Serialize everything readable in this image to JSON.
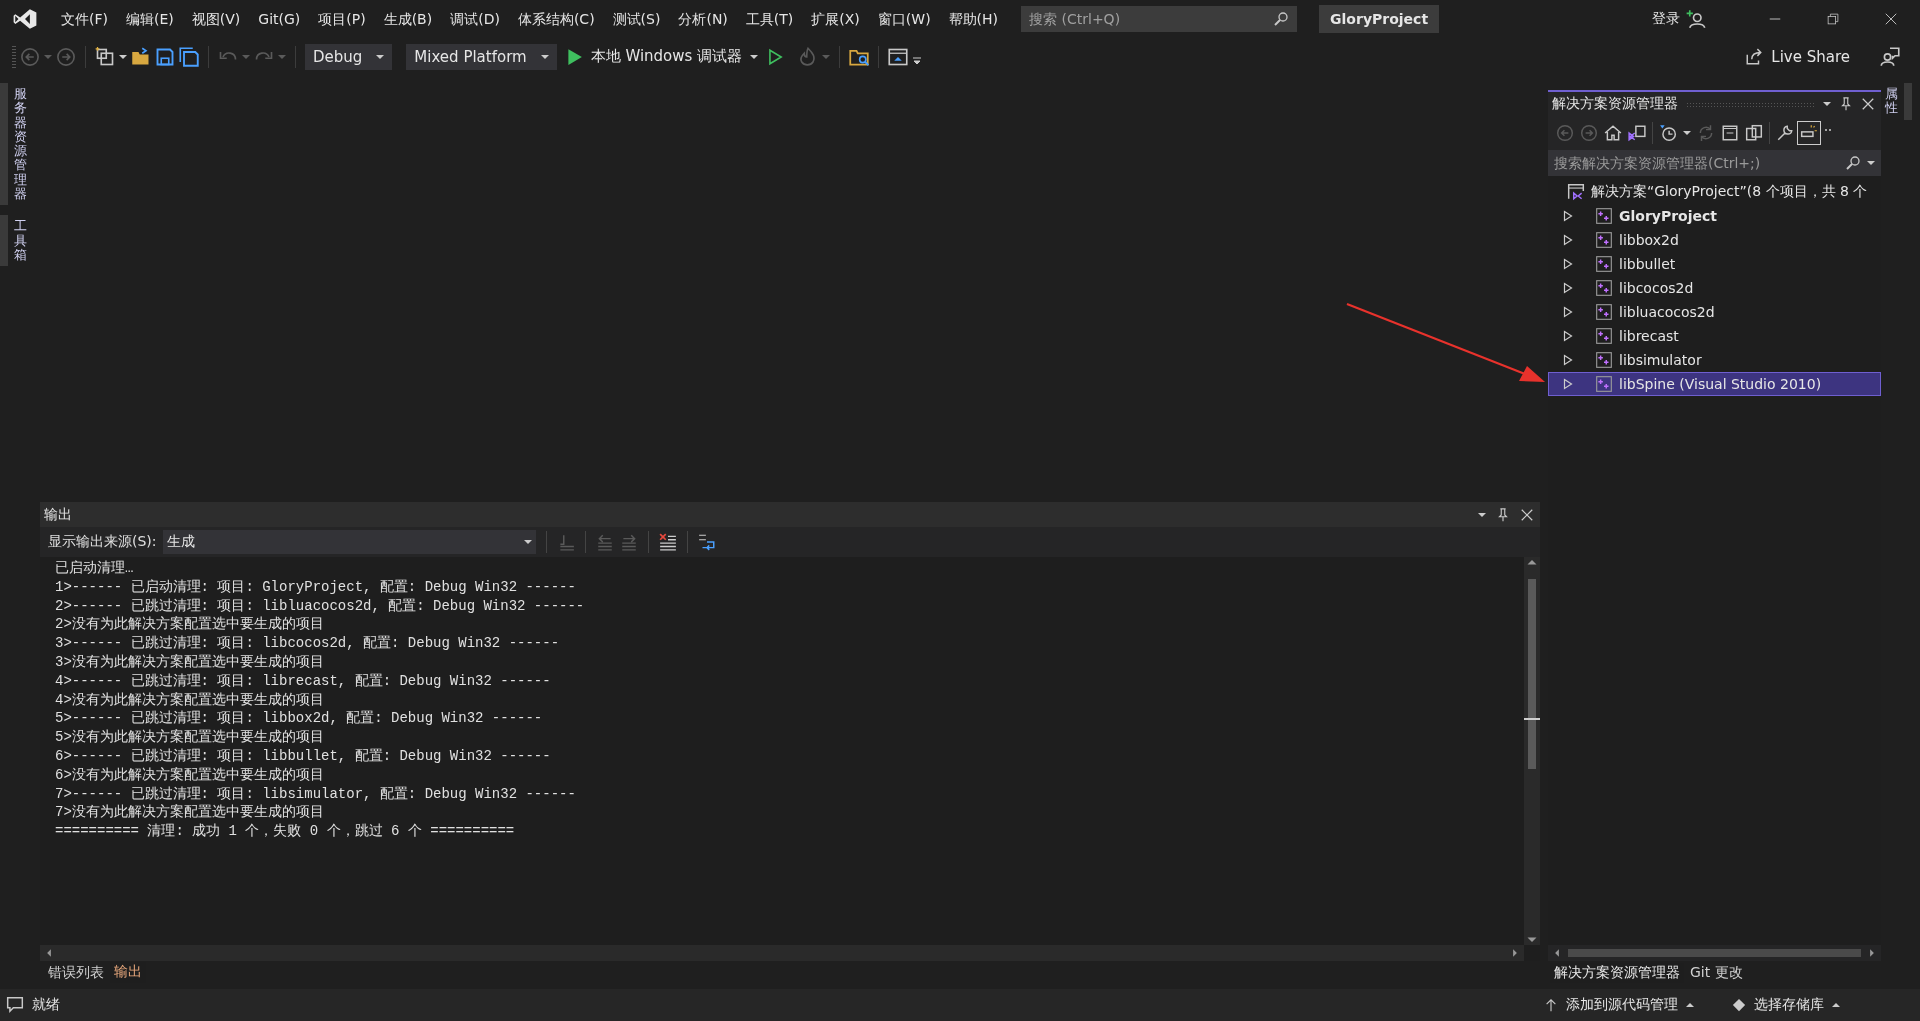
{
  "menu": [
    "文件(F)",
    "编辑(E)",
    "视图(V)",
    "Git(G)",
    "项目(P)",
    "生成(B)",
    "调试(D)",
    "体系结构(C)",
    "测试(S)",
    "分析(N)",
    "工具(T)",
    "扩展(X)",
    "窗口(W)",
    "帮助(H)"
  ],
  "search": {
    "placeholder": "搜索 (Ctrl+Q)"
  },
  "project_badge": "GloryProject",
  "account": {
    "label": "登录"
  },
  "toolbar": {
    "configuration": "Debug",
    "platform": "Mixed Platform",
    "debugger": "本地 Windows 调试器",
    "live_share": "Live Share"
  },
  "left_tabs": [
    "服务器资源管理器",
    "工具箱"
  ],
  "right_tabs": [
    "属性"
  ],
  "output": {
    "title": "输出",
    "source_label": "显示输出来源(S):",
    "source": "生成",
    "lines": [
      "已启动清理…",
      "1>------ 已启动清理: 项目: GloryProject, 配置: Debug Win32 ------",
      "2>------ 已跳过清理: 项目: libluacocos2d, 配置: Debug Win32 ------",
      "2>没有为此解决方案配置选中要生成的项目",
      "3>------ 已跳过清理: 项目: libcocos2d, 配置: Debug Win32 ------",
      "3>没有为此解决方案配置选中要生成的项目",
      "4>------ 已跳过清理: 项目: librecast, 配置: Debug Win32 ------",
      "4>没有为此解决方案配置选中要生成的项目",
      "5>------ 已跳过清理: 项目: libbox2d, 配置: Debug Win32 ------",
      "5>没有为此解决方案配置选中要生成的项目",
      "6>------ 已跳过清理: 项目: libbullet, 配置: Debug Win32 ------",
      "6>没有为此解决方案配置选中要生成的项目",
      "7>------ 已跳过清理: 项目: libsimulator, 配置: Debug Win32 ------",
      "7>没有为此解决方案配置选中要生成的项目",
      "========== 清理: 成功 1 个，失败 0 个，跳过 6 个 =========="
    ]
  },
  "bottom_tabs_left": [
    {
      "label": "错误列表",
      "selected": false
    },
    {
      "label": "输出",
      "selected": true
    }
  ],
  "solution_explorer": {
    "title": "解决方案资源管理器",
    "search_placeholder": "搜索解决方案资源管理器(Ctrl+;)",
    "solution": "解决方案“GloryProject”(8 个项目，共 8 个",
    "projects": [
      {
        "name": "GloryProject",
        "startup": true,
        "selected": false
      },
      {
        "name": "libbox2d",
        "startup": false,
        "selected": false
      },
      {
        "name": "libbullet",
        "startup": false,
        "selected": false
      },
      {
        "name": "libcocos2d",
        "startup": false,
        "selected": false
      },
      {
        "name": "libluacocos2d",
        "startup": false,
        "selected": false
      },
      {
        "name": "librecast",
        "startup": false,
        "selected": false
      },
      {
        "name": "libsimulator",
        "startup": false,
        "selected": false
      },
      {
        "name": "libSpine (Visual Studio 2010)",
        "startup": false,
        "selected": true
      }
    ]
  },
  "bottom_tabs_right": [
    {
      "label": "解决方案资源管理器",
      "selected": true
    },
    {
      "label": "Git 更改",
      "selected": false
    }
  ],
  "status_bar": {
    "status": "就绪",
    "source_control": "添加到源代码管理",
    "repository": "选择存储库"
  },
  "annotation": {
    "kind": "arrow"
  }
}
